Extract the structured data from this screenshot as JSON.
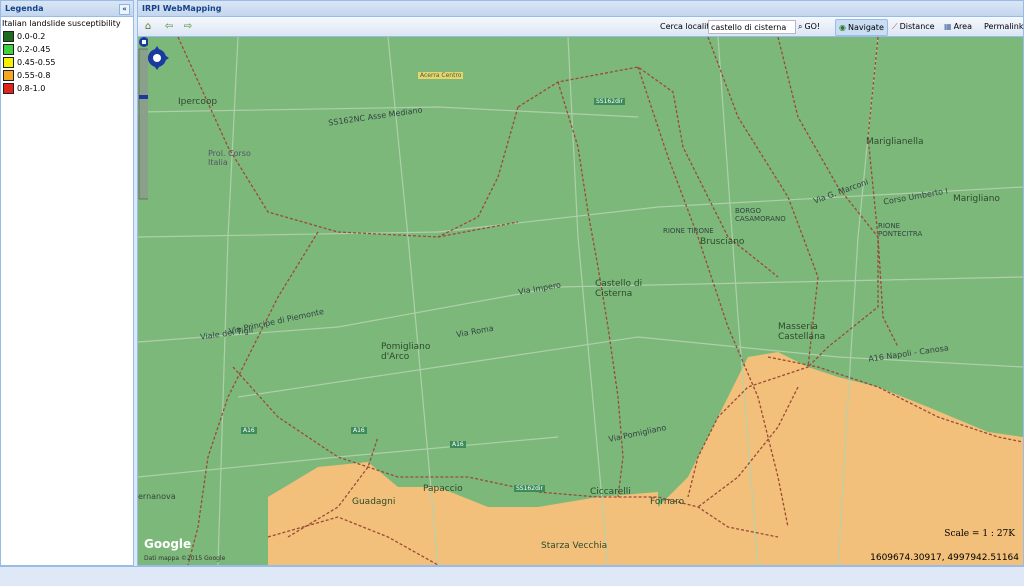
{
  "legend": {
    "header": "Legenda",
    "collapse_label": "«",
    "title": "Italian landslide susceptibility",
    "items": [
      {
        "label": "0.0-0.2",
        "color": "#1f6b1f"
      },
      {
        "label": "0.2-0.45",
        "color": "#3fd13f"
      },
      {
        "label": "0.45-0.55",
        "color": "#f4f200"
      },
      {
        "label": "0.55-0.8",
        "color": "#f5a623"
      },
      {
        "label": "0.8-1.0",
        "color": "#e0261c"
      }
    ]
  },
  "map_panel": {
    "header": "IRPI WebMapping",
    "search_label": "Cerca località:",
    "search_value": "castello di cisterna",
    "go_label": "GO!",
    "navigate_label": "Navigate",
    "distance_label": "Distance",
    "area_label": "Area",
    "permalink_label": "Permalink"
  },
  "map": {
    "scale": "Scale = 1 : 27K",
    "coords": "1609674.30917, 4997942.51164",
    "google": "Google",
    "copyright": "Dati mappa ©2015 Google",
    "labels": {
      "acerra": "Acerra Centro",
      "ipercoop": "Ipercoop",
      "prol_corso": "Prol. Corso Italia",
      "asse": "SS162NC Asse Mediano",
      "ss162dir": "SS162dir",
      "mariglianella": "Mariglianella",
      "marigliano": "Marigliano",
      "rione_tirone": "RIONE TIRONE",
      "brusciano": "Brusciano",
      "castello": "Castello di Cisterna",
      "pomigliano": "Pomigliano d'Arco",
      "masseria": "Masseria Castellana",
      "borgo": "BORGO CASAMORANO",
      "rione_pont": "RIONE PONTECITRA",
      "via_roma": "Via Roma",
      "via_impero": "Via Impero",
      "a16": "A16 Napoli - Canosa",
      "guadagni": "Guadagni",
      "papaccio": "Papaccio",
      "ciccarelli": "Ciccarelli",
      "fornaro": "Fornaro",
      "starza": "Starza Vecchia",
      "ernanova": "ernanova",
      "corso_umberto": "Corso Umberto I",
      "via_marconi": "Via G. Marconi",
      "via_pomigliano": "Via Pomigliano",
      "via_principe": "Via Principe di Piemonte",
      "via_tigli": "Viale dei Tigli",
      "a16_badge": "A16",
      "ss162dir_badge": "SS162dir"
    }
  }
}
